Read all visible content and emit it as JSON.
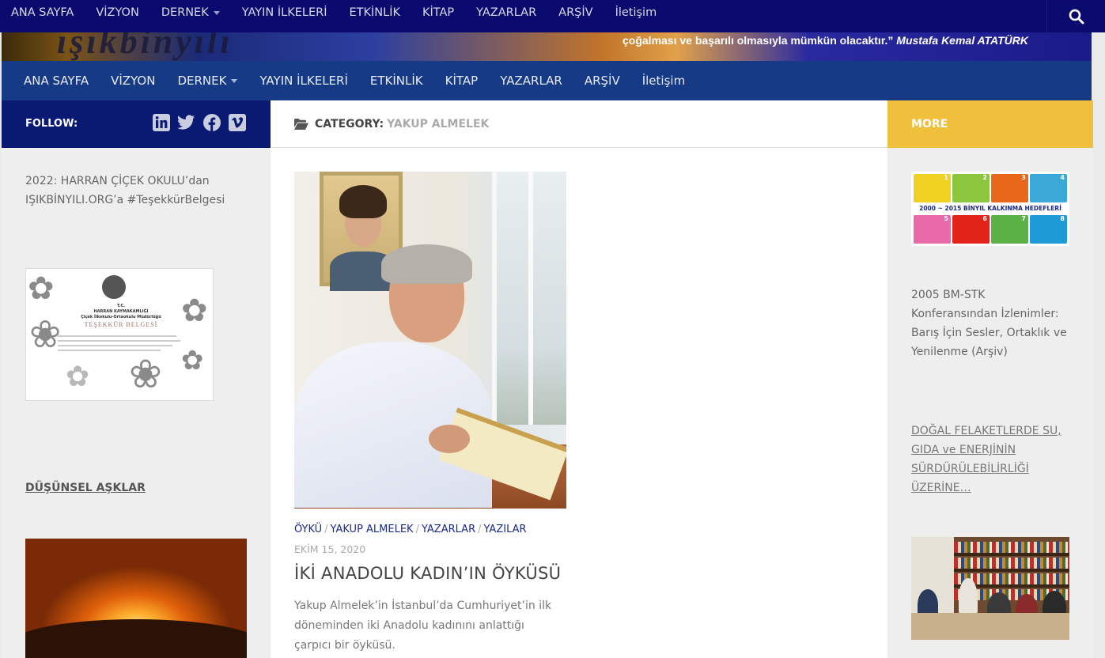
{
  "top_nav": {
    "items": [
      "ANA SAYFA",
      "VİZYON",
      "DERNEK",
      "YAYIN İLKELERİ",
      "ETKİNLİK",
      "KİTAP",
      "YAZARLAR",
      "ARŞİV",
      "İletişim"
    ]
  },
  "banner": {
    "quote": "çoğalması ve başarılı olmasıyla mümkün olacaktır.”",
    "author": "Mustafa Kemal ATATÜRK"
  },
  "main_nav": {
    "items": [
      "ANA SAYFA",
      "VİZYON",
      "DERNEK",
      "YAYIN İLKELERİ",
      "ETKİNLİK",
      "KİTAP",
      "YAZARLAR",
      "ARŞİV",
      "İletişim"
    ]
  },
  "left_sidebar": {
    "follow_label": "FOLLOW:",
    "social_icons": [
      "linkedin-icon",
      "twitter-icon",
      "facebook-icon",
      "vimeo-icon"
    ],
    "widget_text": "2022: HARRAN ÇİÇEK OKULU’dan IŞIKBİNYILI.ORG’a #TeşekkürBelgesi",
    "certificate": {
      "org_lines": [
        "T.C.",
        "HARRAN KAYMAKAMLIĞI",
        "Çiçek İlkokulu-Ortaokulu Müdürlüğü"
      ],
      "title": "TEŞEKKÜR BELGESİ"
    },
    "link_heading": "DÜŞÜNSEL AŞKLAR"
  },
  "content": {
    "heading_label": "CATEGORY:",
    "category": "YAKUP ALMELEK",
    "post": {
      "categories": [
        "ÖYKÜ",
        "YAKUP ALMELEK",
        "YAZARLAR",
        "YAZILAR"
      ],
      "separator": "/",
      "date": "EKİM 15, 2020",
      "title": "İKİ ANADOLU KADIN’IN ÖYKÜSÜ",
      "excerpt": "Yakup Almelek’in İstanbul’da Cumhuriyet’in ilk döneminden iki Anadolu kadınını anlattığı çarpıcı bir öyküsü."
    }
  },
  "right_sidebar": {
    "heading": "MORE",
    "mdg_banner": "2000 ~ 2015 BİNYIL KALKINMA HEDEFLERİ",
    "mdg_numbers": [
      "1",
      "2",
      "3",
      "4",
      "5",
      "6",
      "7",
      "8"
    ],
    "mdg_colors": [
      "#f0d020",
      "#8cc63f",
      "#e8671b",
      "#3aa9d8",
      "#e96aa8",
      "#e2231a",
      "#5bb046",
      "#1e9bd7"
    ],
    "text": "2005 BM-STK Konferansından İzlenimler: Barış İçin Sesler, Ortaklık ve Yenilenme (Arşiv)",
    "link": "DOĞAL FELAKETLERDE SU, GIDA ve ENERJİNİN SÜRDÜRÜLEBİLİRLİĞİ ÜZERİNE…"
  },
  "colors": {
    "top_nav_bg": "#0a0a6e",
    "main_nav_bg": "#173a86",
    "follow_bar_bg": "#0a1a72",
    "more_bar_bg": "#f0bf3c",
    "link_color": "#1a2a86"
  }
}
